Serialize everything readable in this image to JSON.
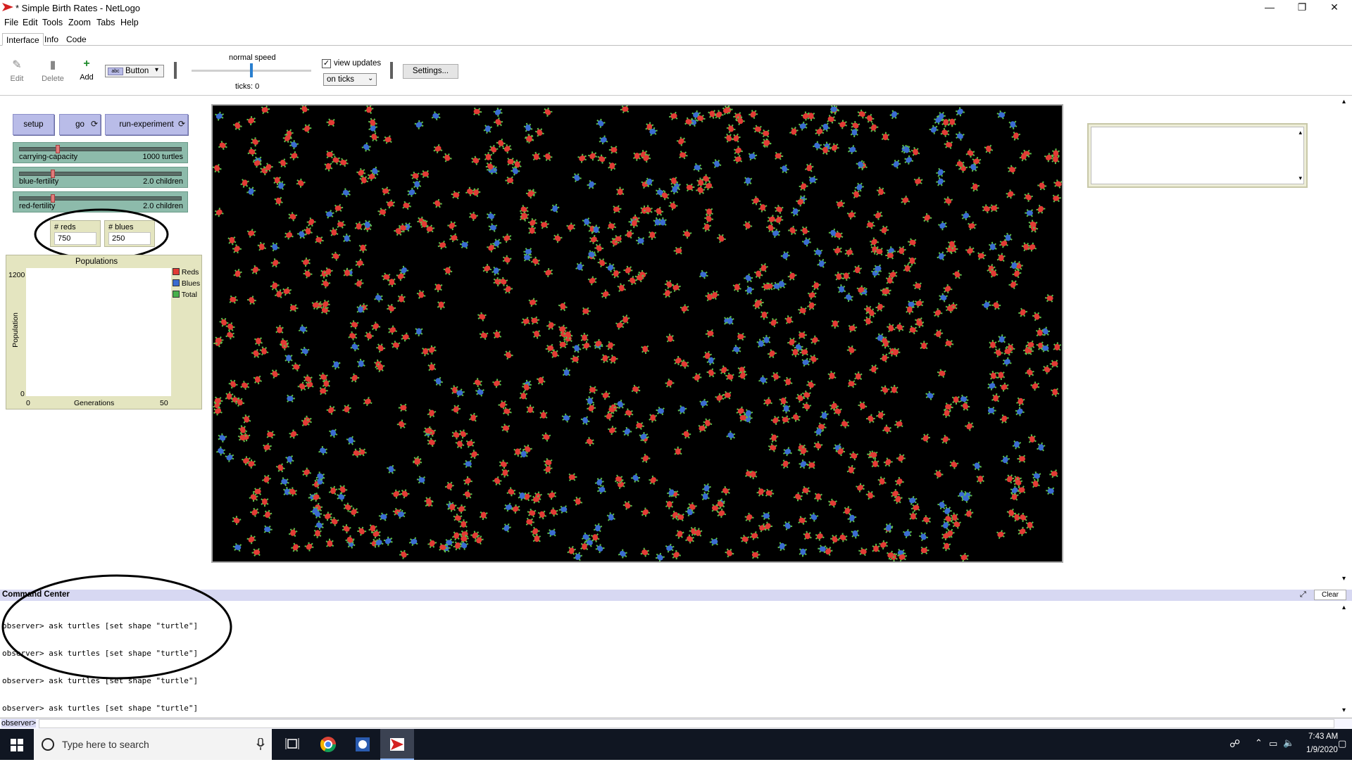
{
  "window": {
    "title": "* Simple Birth Rates - NetLogo",
    "controls": [
      "—",
      "❐",
      "✕"
    ]
  },
  "menubar": [
    "File",
    "Edit",
    "Tools",
    "Zoom",
    "Tabs",
    "Help"
  ],
  "tabs": [
    "Interface",
    "Info",
    "Code"
  ],
  "toolbar": {
    "edit_label": "Edit",
    "delete_label": "Delete",
    "add_label": "Add",
    "widget_type": "Button",
    "speed_label": "normal speed",
    "ticks_label": "ticks: 0",
    "view_updates_label": "view updates",
    "view_updates_checked": true,
    "update_mode": "on ticks",
    "settings_label": "Settings...",
    "speed_fraction": 0.5
  },
  "buttons": {
    "setup": "setup",
    "go": "go",
    "run_experiment": "run-experiment"
  },
  "sliders": [
    {
      "name": "carrying-capacity",
      "value": "1000 turtles",
      "fraction": 0.23
    },
    {
      "name": "blue-fertility",
      "value": "2.0 children",
      "fraction": 0.2
    },
    {
      "name": "red-fertility",
      "value": "2.0 children",
      "fraction": 0.2
    }
  ],
  "monitors": {
    "reds_label": "# reds",
    "reds_value": "750",
    "blues_label": "# blues",
    "blues_value": "250"
  },
  "plot": {
    "title": "Populations",
    "ylabel": "Population",
    "xlabel": "Generations",
    "ymax": "1200",
    "ymin": "0",
    "xmin": "0",
    "xmax": "50",
    "legend": [
      {
        "name": "Reds",
        "color": "#e23b35"
      },
      {
        "name": "Blues",
        "color": "#3a6cd1"
      },
      {
        "name": "Total",
        "color": "#48b04a"
      }
    ]
  },
  "world": {
    "turtle_counts": {
      "reds": 750,
      "blues": 250
    },
    "turtle_colors": {
      "red": "#e23b35",
      "blue": "#3a6cd1",
      "legs": "#5bbf4a"
    }
  },
  "command_center": {
    "title": "Command Center",
    "clear_label": "Clear",
    "history": [
      "observer> ask turtles [set shape \"turtle\"]",
      "observer> ask turtles [set shape \"turtle\"]",
      "observer> ask turtles [set shape \"turtle\"]",
      "observer> ask turtles [set shape \"turtle\"]"
    ],
    "prompt": "observer>"
  },
  "taskbar": {
    "search_placeholder": "Type here to search",
    "time": "7:43 AM",
    "date": "1/9/2020"
  }
}
